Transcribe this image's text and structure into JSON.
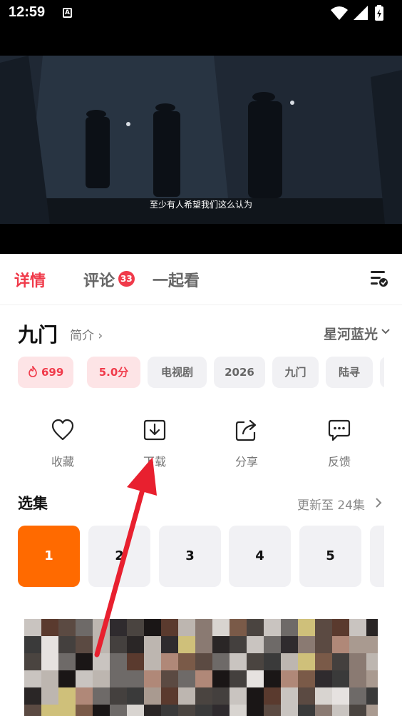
{
  "status_bar": {
    "time": "12:59",
    "notification_icon": "A"
  },
  "video": {
    "subtitle": "至少有人希望我们这么认为"
  },
  "tabs": [
    {
      "label": "详情",
      "active": true
    },
    {
      "label": "评论",
      "badge": "33"
    },
    {
      "label": "一起看"
    }
  ],
  "show": {
    "title": "九门",
    "intro": "简介",
    "source": "星河蓝光"
  },
  "chips": [
    {
      "text": "699",
      "icon": "flame-icon",
      "hot": true
    },
    {
      "text": "5.0分",
      "hot": true
    },
    {
      "text": "电视剧"
    },
    {
      "text": "2026"
    },
    {
      "text": "九门"
    },
    {
      "text": "陆寻"
    }
  ],
  "actions": [
    {
      "label": "收藏",
      "icon": "heart-icon"
    },
    {
      "label": "下载",
      "icon": "download-icon"
    },
    {
      "label": "分享",
      "icon": "share-icon"
    },
    {
      "label": "反馈",
      "icon": "feedback-icon"
    }
  ],
  "episodes_section": {
    "title": "选集",
    "update_text": "更新至 24集",
    "episodes": [
      "1",
      "2",
      "3",
      "4",
      "5"
    ],
    "active_episode": "1"
  },
  "colors": {
    "accent_red": "#f03a4a",
    "accent_orange": "#ff6a00",
    "annotation_arrow": "#e8202f"
  }
}
